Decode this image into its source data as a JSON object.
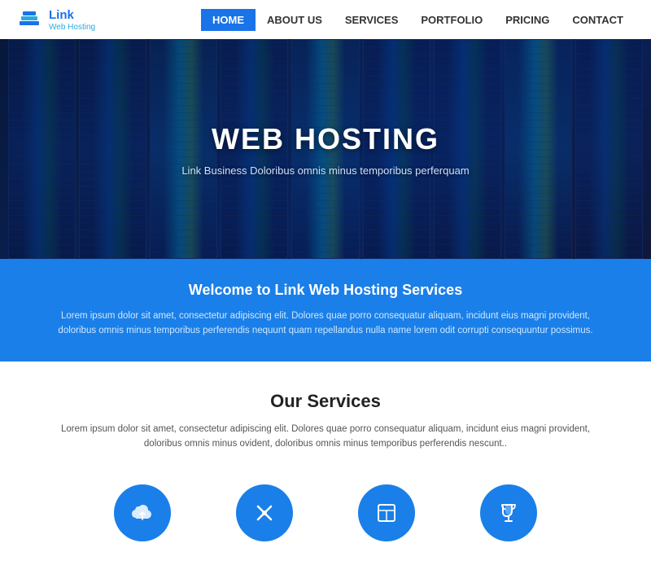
{
  "header": {
    "logo_name": "Link",
    "logo_sub": "Web Hosting",
    "nav": [
      {
        "label": "HOME",
        "active": true
      },
      {
        "label": "ABOUT US",
        "active": false
      },
      {
        "label": "SERVICES",
        "active": false
      },
      {
        "label": "PORTFOLIO",
        "active": false
      },
      {
        "label": "PRICING",
        "active": false
      },
      {
        "label": "CONTACT",
        "active": false
      }
    ]
  },
  "hero": {
    "title": "WEB HOSTING",
    "subtitle": "Link Business Doloribus omnis minus temporibus perferquam"
  },
  "welcome": {
    "title": "Welcome to Link Web Hosting Services",
    "text": "Lorem ipsum dolor sit amet, consectetur adipiscing elit. Dolores quae porro consequatur aliquam, incidunt eius magni provident, doloribus omnis minus temporibus perferendis nequunt quam repellandus nulla name lorem odit corrupti consequuntur possimus."
  },
  "services": {
    "title": "Our Services",
    "text": "Lorem ipsum dolor sit amet, consectetur adipiscing elit. Dolores quae porro consequatur aliquam, incidunt eius magni provident, doloribus omnis minus ovident, doloribus omnis minus temporibus perferendis nescunt..",
    "icons": [
      {
        "name": "cloud-upload",
        "symbol": "☁"
      },
      {
        "name": "tools",
        "symbol": "✂"
      },
      {
        "name": "table-layout",
        "symbol": "▦"
      },
      {
        "name": "trophy",
        "symbol": "🏆"
      }
    ]
  }
}
